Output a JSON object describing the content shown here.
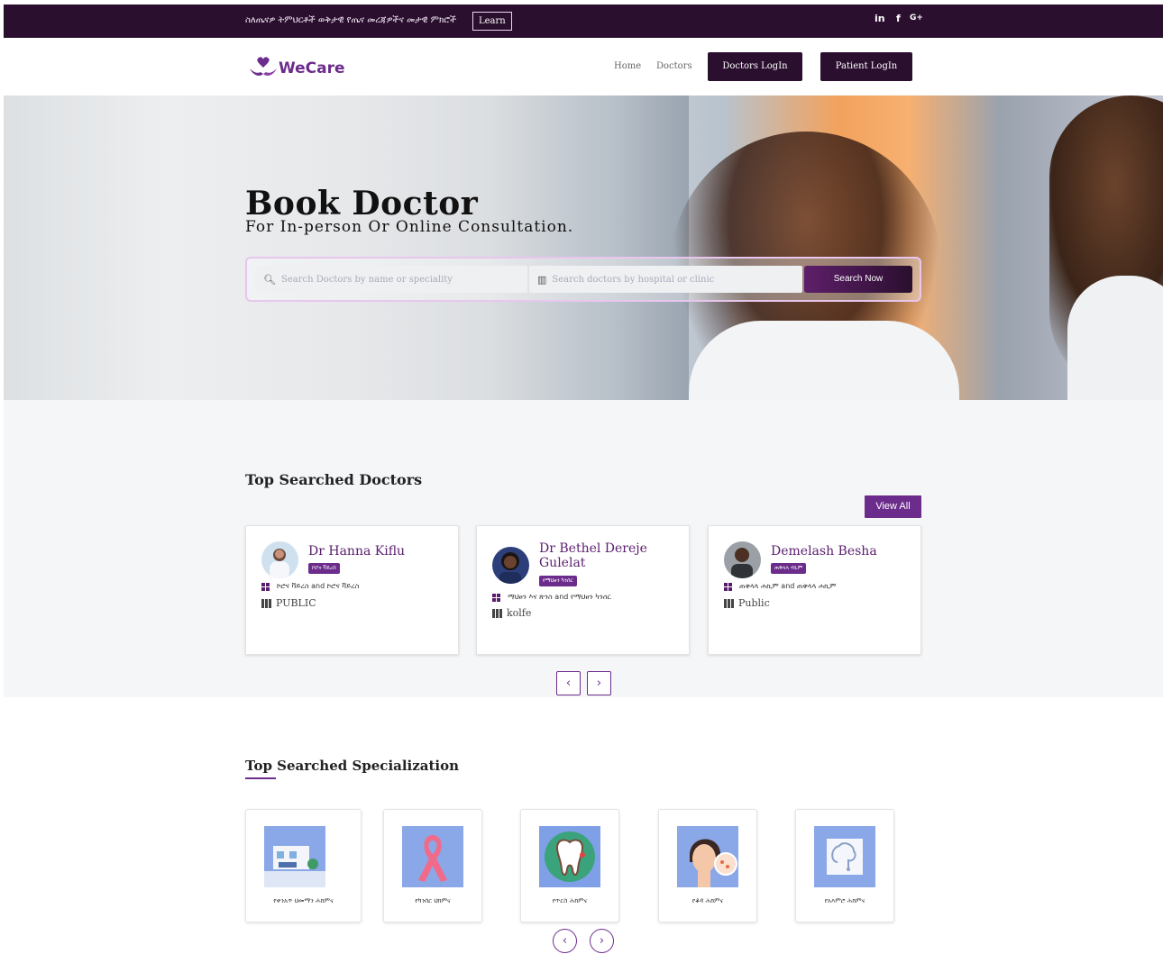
{
  "topbar": {
    "announcement": "ስለጤናዎ ትምህርቶች ወቅታዊ የጤና መረጃዎችና መታዊ ምክሮች",
    "learn_label": "Learn",
    "social": {
      "linkedin": "in",
      "facebook": "f",
      "google": "G+"
    }
  },
  "nav": {
    "brand": "WeCare",
    "links": [
      "Home",
      "Doctors"
    ],
    "doctors_login": "Doctors LogIn",
    "patient_login": "Patient LogIn"
  },
  "hero": {
    "title": "Book Doctor",
    "subtitle": "For In-person Or Online Consultation.",
    "search_name_placeholder": "Search Doctors by name or speciality",
    "search_hospital_placeholder": "Search doctors by hospital or clinic",
    "search_button": "Search Now"
  },
  "top_doctors": {
    "heading": "Top Searched Doctors",
    "view_all": "View All",
    "doctors": [
      {
        "name": "Dr Hanna Kiflu",
        "badge": "ኮሮና ቫይረስ",
        "specialty": "ኮሮና ቫይረስ and ኮሮና ቫይረስ",
        "location": "PUBLIC"
      },
      {
        "name": "Dr Bethel Dereje Gulelat",
        "badge": "የማህፀን ካንሰር",
        "specialty": "ማህፀን እና ጽንስ and የማህፀን ካንሰር",
        "location": "kolfe"
      },
      {
        "name": "Demelash Besha",
        "badge": "ጠቅላላ ሃኪም",
        "specialty": "ጠቅላላ ሐኪም and ጠቅላላ ሐኪም",
        "location": "Public"
      }
    ],
    "prev": "‹",
    "next": "›"
  },
  "specializations": {
    "heading": "Top Searched Specialization",
    "items": [
      {
        "label": "የቀንአጥ ህመማን ሕክምና",
        "icon": "clinic-icon"
      },
      {
        "label": "የካንሰር ህክምና",
        "icon": "ribbon-icon"
      },
      {
        "label": "የጥርስ ሕክምና",
        "icon": "tooth-icon"
      },
      {
        "label": "የቆዳ ሕክምና",
        "icon": "skin-icon"
      },
      {
        "label": "የአእምሮ ሕክምና",
        "icon": "brain-icon"
      }
    ],
    "prev": "‹",
    "next": "›"
  },
  "colors": {
    "brand_purple": "#6c2c8c",
    "dark_plum": "#2a0f2e"
  }
}
